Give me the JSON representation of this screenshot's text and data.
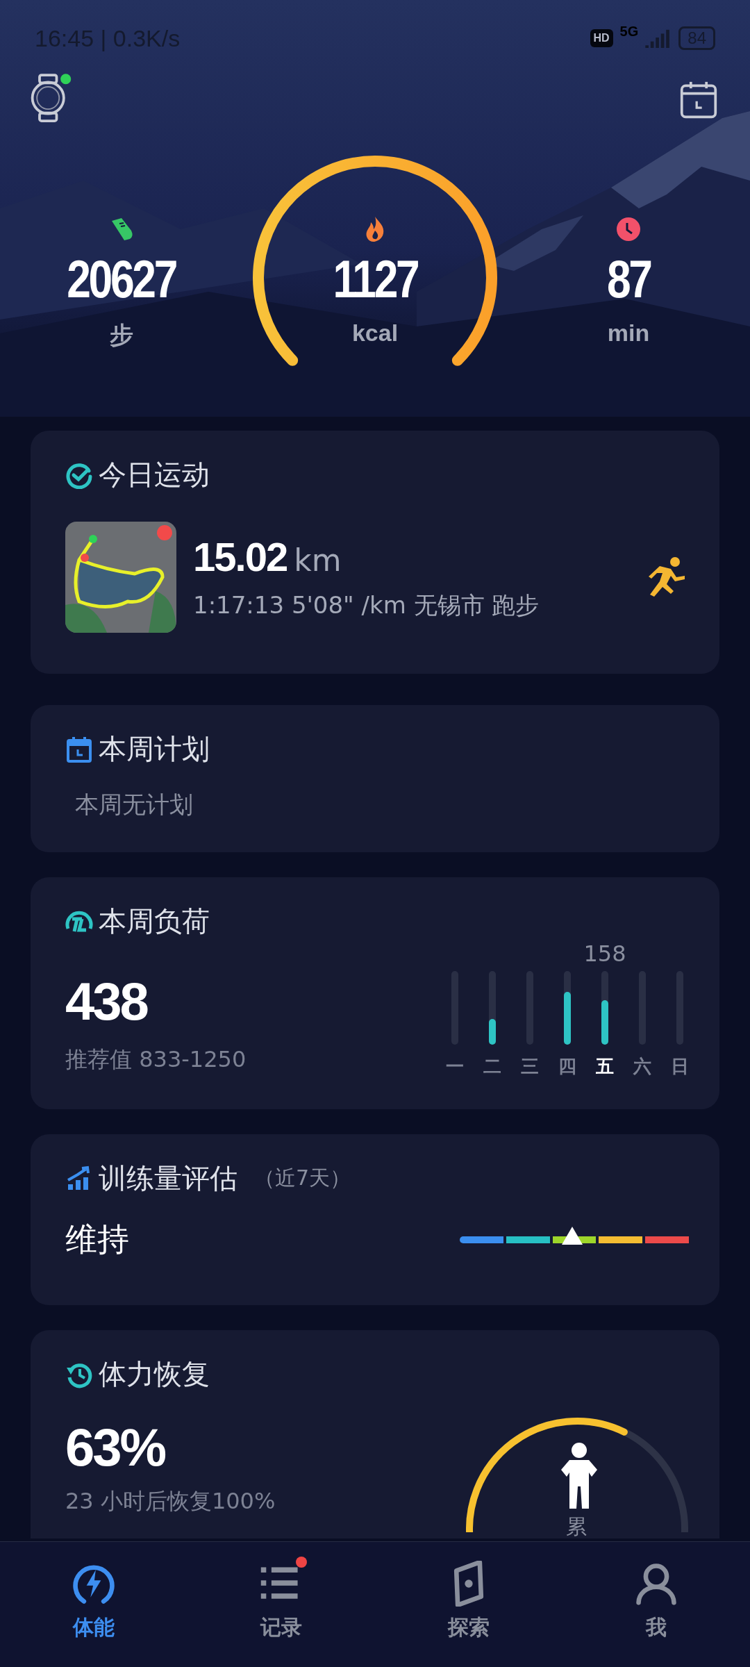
{
  "status_bar": {
    "time": "16:45 | 0.3K/s",
    "hd": "HD",
    "network": "5G",
    "battery": "84"
  },
  "header": {
    "watch_connected": true
  },
  "stats": [
    {
      "kind": "steps",
      "value": "20627",
      "unit": "步"
    },
    {
      "kind": "calories",
      "value": "1127",
      "unit": "kcal"
    },
    {
      "kind": "duration",
      "value": "87",
      "unit": "min"
    }
  ],
  "today_workout": {
    "title": "今日运动",
    "distance": "15.02",
    "unit": "km",
    "details": "1:17:13 5'08\" /km  无锡市 跑步"
  },
  "weekly_plan": {
    "title": "本周计划",
    "text": "本周无计划"
  },
  "weekly_load": {
    "title": "本周负荷",
    "value": "438",
    "recommended": "推荐值 833-1250",
    "days": [
      {
        "label": "一",
        "selected": false
      },
      {
        "label": "二",
        "level": 0.35,
        "selected": false
      },
      {
        "label": "三",
        "selected": false
      },
      {
        "label": "四",
        "level": 0.72,
        "selected": false
      },
      {
        "label": "五",
        "level": 0.6,
        "selected": true,
        "value": "158"
      },
      {
        "label": "六",
        "selected": false
      },
      {
        "label": "日",
        "selected": false
      }
    ]
  },
  "training_assessment": {
    "title": "训练量评估",
    "period": "（近7天）",
    "status": "维持",
    "segments": [
      {
        "color": "#3b8ff0"
      },
      {
        "color": "#27c0c4"
      },
      {
        "color": "#9ed62a"
      },
      {
        "color": "#f4bd32"
      },
      {
        "color": "#ec4a4a"
      }
    ]
  },
  "recovery": {
    "title": "体力恢复",
    "value": "63%",
    "text": "23 小时后恢复100%",
    "state": "累"
  },
  "tabs": [
    {
      "label": "体能",
      "kind": "fitness",
      "selected": true,
      "badge": false
    },
    {
      "label": "记录",
      "kind": "records",
      "selected": false,
      "badge": true
    },
    {
      "label": "探索",
      "kind": "explore",
      "selected": false,
      "badge": false
    },
    {
      "label": "我",
      "kind": "me",
      "selected": false,
      "badge": false
    }
  ]
}
